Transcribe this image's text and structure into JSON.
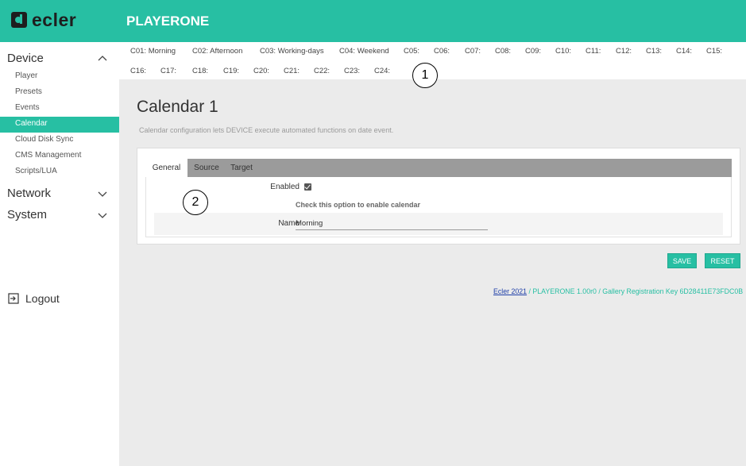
{
  "header": {
    "logo_text": "ecler",
    "app_title": "PLAYERONE"
  },
  "sidebar": {
    "groups": [
      {
        "label": "Device",
        "expanded": true
      },
      {
        "label": "Network",
        "expanded": false
      },
      {
        "label": "System",
        "expanded": false
      }
    ],
    "device_items": [
      "Player",
      "Presets",
      "Events",
      "Calendar",
      "Cloud Disk Sync",
      "CMS Management",
      "Scripts/LUA"
    ],
    "active_item": "Calendar",
    "logout_label": "Logout"
  },
  "calendar_tabs": [
    "C01: Morning",
    "C02: Afternoon",
    "C03: Working-days",
    "C04: Weekend",
    "C05:",
    "C06:",
    "C07:",
    "C08:",
    "C09:",
    "C10:",
    "C11:",
    "C12:",
    "C13:",
    "C14:",
    "C15:",
    "C16:",
    "C17:",
    "C18:",
    "C19:",
    "C20:",
    "C21:",
    "C22:",
    "C23:",
    "C24:"
  ],
  "callouts": [
    "1",
    "2"
  ],
  "page": {
    "title": "Calendar 1",
    "description": "Calendar configuration lets DEVICE execute automated functions on date event."
  },
  "panel": {
    "tabs": [
      "General",
      "Source",
      "Target"
    ],
    "active_tab": "General",
    "enabled_label": "Enabled",
    "enabled_checked": true,
    "enabled_hint": "Check this option to enable calendar",
    "name_label": "Name",
    "name_value": "Morning"
  },
  "buttons": {
    "save": "SAVE",
    "reset": "RESET"
  },
  "footer": {
    "link_text": "Ecler 2021",
    "rest_text": " / PLAYERONE 1.00r0 / Gallery Registration Key 6D28411E73FDC0B"
  },
  "colors": {
    "accent": "#27bfa3",
    "tab_bar": "#9b9b9b",
    "content_bg": "#ebebeb"
  }
}
